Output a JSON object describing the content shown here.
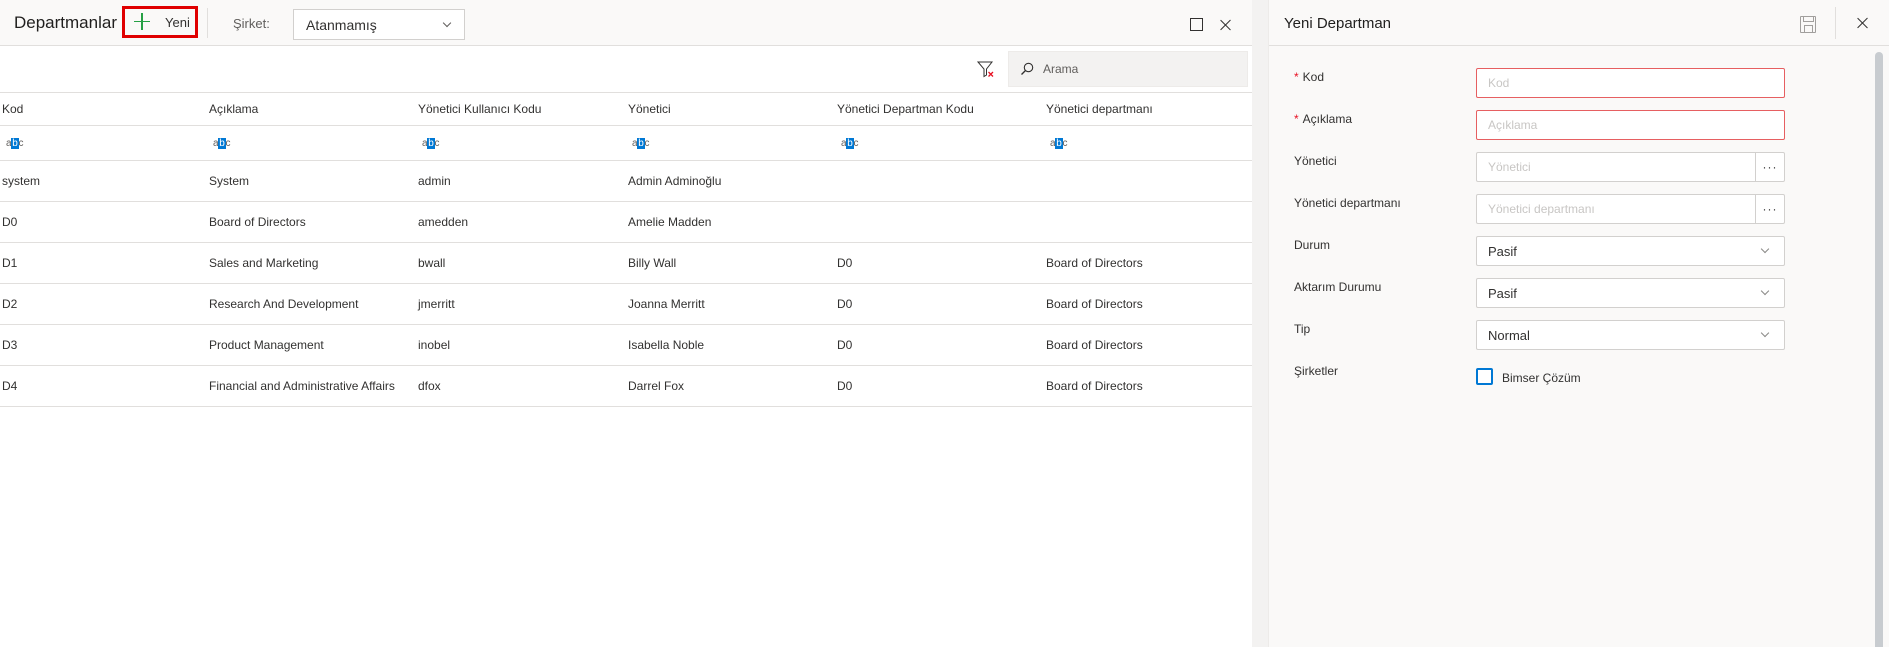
{
  "list_panel": {
    "title": "Departmanlar",
    "new_button_label": "Yeni",
    "company_label": "Şirket:",
    "company_value": "Atanmamış",
    "search_placeholder": "Arama",
    "columns": [
      "Kod",
      "Açıklama",
      "Yönetici Kullanıcı Kodu",
      "Yönetici",
      "Yönetici Departman Kodu",
      "Yönetici departmanı"
    ],
    "filter_icon_text": {
      "a": "a",
      "b": "b",
      "c": "c"
    },
    "rows": [
      [
        "system",
        "System",
        "admin",
        "Admin Adminoğlu",
        "",
        ""
      ],
      [
        "D0",
        "Board of Directors",
        "amedden",
        "Amelie Madden",
        "",
        ""
      ],
      [
        "D1",
        "Sales and Marketing",
        "bwall",
        "Billy Wall",
        "D0",
        "Board of Directors"
      ],
      [
        "D2",
        "Research And Development",
        "jmerritt",
        "Joanna Merritt",
        "D0",
        "Board of Directors"
      ],
      [
        "D3",
        "Product Management",
        "inobel",
        "Isabella Noble",
        "D0",
        "Board of Directors"
      ],
      [
        "D4",
        "Financial and Administrative Affairs",
        "dfox",
        "Darrel Fox",
        "D0",
        "Board of Directors"
      ]
    ]
  },
  "form_panel": {
    "title": "Yeni Departman",
    "required_marker": "*",
    "fields": {
      "kod": {
        "label": "Kod",
        "placeholder": "Kod"
      },
      "aciklama": {
        "label": "Açıklama",
        "placeholder": "Açıklama"
      },
      "yonetici": {
        "label": "Yönetici",
        "placeholder": "Yönetici",
        "button": "···"
      },
      "yonetici_departmani": {
        "label": "Yönetici departmanı",
        "placeholder": "Yönetici departmanı",
        "button": "···"
      },
      "durum": {
        "label": "Durum",
        "value": "Pasif"
      },
      "aktarim_durumu": {
        "label": "Aktarım Durumu",
        "value": "Pasif"
      },
      "tip": {
        "label": "Tip",
        "value": "Normal"
      },
      "sirketler": {
        "label": "Şirketler",
        "option": "Bimser Çözüm",
        "checked": false
      }
    }
  },
  "colors": {
    "accent": "#0078d4",
    "highlight_border": "#e00000",
    "error_border": "#e65f61",
    "plus_icon": "#26a045"
  }
}
